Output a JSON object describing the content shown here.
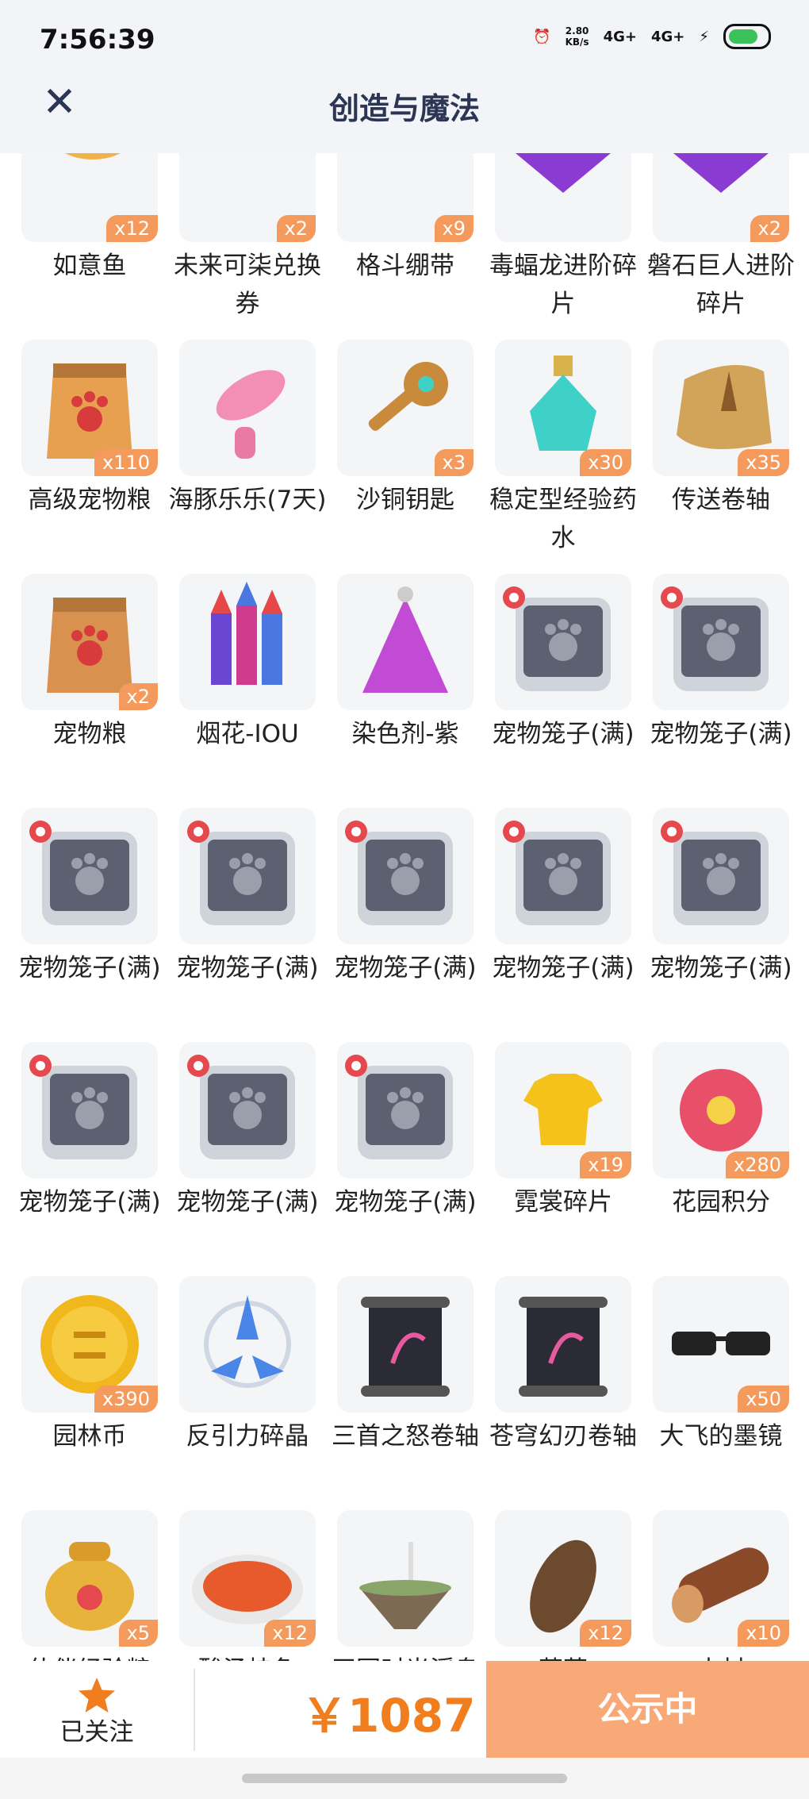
{
  "status_bar": {
    "time": "7:56:39",
    "speed": "2.80",
    "speed_unit": "KB/s",
    "net1": "4G+",
    "net2": "4G+"
  },
  "header": {
    "title": "创造与魔法"
  },
  "items": [
    {
      "name": "如意鱼",
      "count": "x12",
      "icon": "fish-icon",
      "color": "#f2b24b"
    },
    {
      "name": "未来可柒兑换券",
      "count": "x2",
      "icon": "ticket-icon",
      "color": "#e5483a"
    },
    {
      "name": "格斗绷带",
      "count": "x9",
      "icon": "bandage-icon",
      "color": "#e9d8c2"
    },
    {
      "name": "毒蝠龙进阶碎片",
      "count": "",
      "icon": "crystal-icon",
      "color": "#8a3bd1"
    },
    {
      "name": "磐石巨人进阶碎片",
      "count": "x2",
      "icon": "crystal-icon",
      "color": "#8a3bd1"
    },
    {
      "name": "高级宠物粮",
      "count": "x110",
      "icon": "pet-food-bag-icon",
      "color": "#e7a04f"
    },
    {
      "name": "海豚乐乐(7天)",
      "count": "",
      "icon": "dolphin-icon",
      "color": "#f28fb3"
    },
    {
      "name": "沙铜钥匙",
      "count": "x3",
      "icon": "key-icon",
      "color": "#c98a3b"
    },
    {
      "name": "稳定型经验药水",
      "count": "x30",
      "icon": "potion-icon",
      "color": "#3fd0c8"
    },
    {
      "name": "传送卷轴",
      "count": "x35",
      "icon": "scroll-icon",
      "color": "#d1a45a"
    },
    {
      "name": "宠物粮",
      "count": "x2",
      "icon": "pet-food-bag-icon",
      "color": "#d99150"
    },
    {
      "name": "烟花-IOU",
      "count": "",
      "icon": "fireworks-icon",
      "color": "#7a4fd0"
    },
    {
      "name": "染色剂-紫",
      "count": "",
      "icon": "dye-icon",
      "color": "#c24bd6"
    },
    {
      "name": "宠物笼子(满)",
      "count": "",
      "icon": "pet-cage-icon",
      "color": "#5b6170"
    },
    {
      "name": "宠物笼子(满)",
      "count": "",
      "icon": "pet-cage-icon",
      "color": "#5b6170"
    },
    {
      "name": "宠物笼子(满)",
      "count": "",
      "icon": "pet-cage-icon",
      "color": "#5b6170"
    },
    {
      "name": "宠物笼子(满)",
      "count": "",
      "icon": "pet-cage-icon",
      "color": "#5b6170"
    },
    {
      "name": "宠物笼子(满)",
      "count": "",
      "icon": "pet-cage-icon",
      "color": "#5b6170"
    },
    {
      "name": "宠物笼子(满)",
      "count": "",
      "icon": "pet-cage-icon",
      "color": "#5b6170"
    },
    {
      "name": "宠物笼子(满)",
      "count": "",
      "icon": "pet-cage-icon",
      "color": "#5b6170"
    },
    {
      "name": "宠物笼子(满)",
      "count": "",
      "icon": "pet-cage-icon",
      "color": "#5b6170"
    },
    {
      "name": "宠物笼子(满)",
      "count": "",
      "icon": "pet-cage-icon",
      "color": "#5b6170"
    },
    {
      "name": "宠物笼子(满)",
      "count": "",
      "icon": "pet-cage-icon",
      "color": "#5b6170"
    },
    {
      "name": "霓裳碎片",
      "count": "x19",
      "icon": "shirt-icon",
      "color": "#f5c21b"
    },
    {
      "name": "花园积分",
      "count": "x280",
      "icon": "flower-icon",
      "color": "#e8506a"
    },
    {
      "name": "园林币",
      "count": "x390",
      "icon": "coin-icon",
      "color": "#f0b81d"
    },
    {
      "name": "反引力碎晶",
      "count": "",
      "icon": "gravity-crystal-icon",
      "color": "#4a86e8"
    },
    {
      "name": "三首之怒卷轴",
      "count": "",
      "icon": "dark-scroll-icon",
      "color": "#2b2b35"
    },
    {
      "name": "苍穹幻刃卷轴",
      "count": "",
      "icon": "dark-scroll-icon",
      "color": "#2b2b35"
    },
    {
      "name": "大飞的墨镜",
      "count": "x50",
      "icon": "sunglasses-icon",
      "color": "#222222"
    },
    {
      "name": "伙伴经验粮",
      "count": "x5",
      "icon": "treasure-bag-icon",
      "color": "#e8b33a"
    },
    {
      "name": "酸汤桂鱼",
      "count": "x12",
      "icon": "fish-dish-icon",
      "color": "#e65a2b"
    },
    {
      "name": "田园时光浮岛皮肤",
      "count": "",
      "icon": "island-icon",
      "color": "#7c6a55"
    },
    {
      "name": "茅草",
      "count": "x12",
      "icon": "thatch-icon",
      "color": "#6b4a2e"
    },
    {
      "name": "木材",
      "count": "x10",
      "icon": "log-icon",
      "color": "#8a4a2a"
    }
  ],
  "footer": {
    "follow_label": "已关注",
    "price": "￥1087",
    "status_button": "公示中"
  },
  "colors": {
    "accent": "#f07d1e",
    "badge": "#f39a5c",
    "cta": "#f9a878"
  }
}
